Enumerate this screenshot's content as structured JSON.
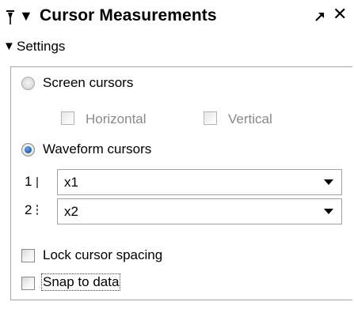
{
  "panel": {
    "title": "Cursor Measurements",
    "settings_label": "Settings"
  },
  "screen_cursors": {
    "label": "Screen cursors",
    "selected": false,
    "horizontal_label": "Horizontal",
    "vertical_label": "Vertical"
  },
  "waveform_cursors": {
    "label": "Waveform cursors",
    "selected": true,
    "cursor1_index": "1",
    "cursor1_value": "x1",
    "cursor2_index": "2",
    "cursor2_value": "x2"
  },
  "options": {
    "lock_spacing_label": "Lock cursor spacing",
    "lock_spacing_checked": false,
    "snap_label": "Snap to data",
    "snap_checked": false
  },
  "icons": {
    "pin": "pin-icon",
    "title_caret": "caret-down-icon",
    "undock": "undock-arrow-icon",
    "close": "close-icon",
    "settings_caret": "caret-down-icon",
    "combo_arrow": "chevron-down-icon"
  }
}
